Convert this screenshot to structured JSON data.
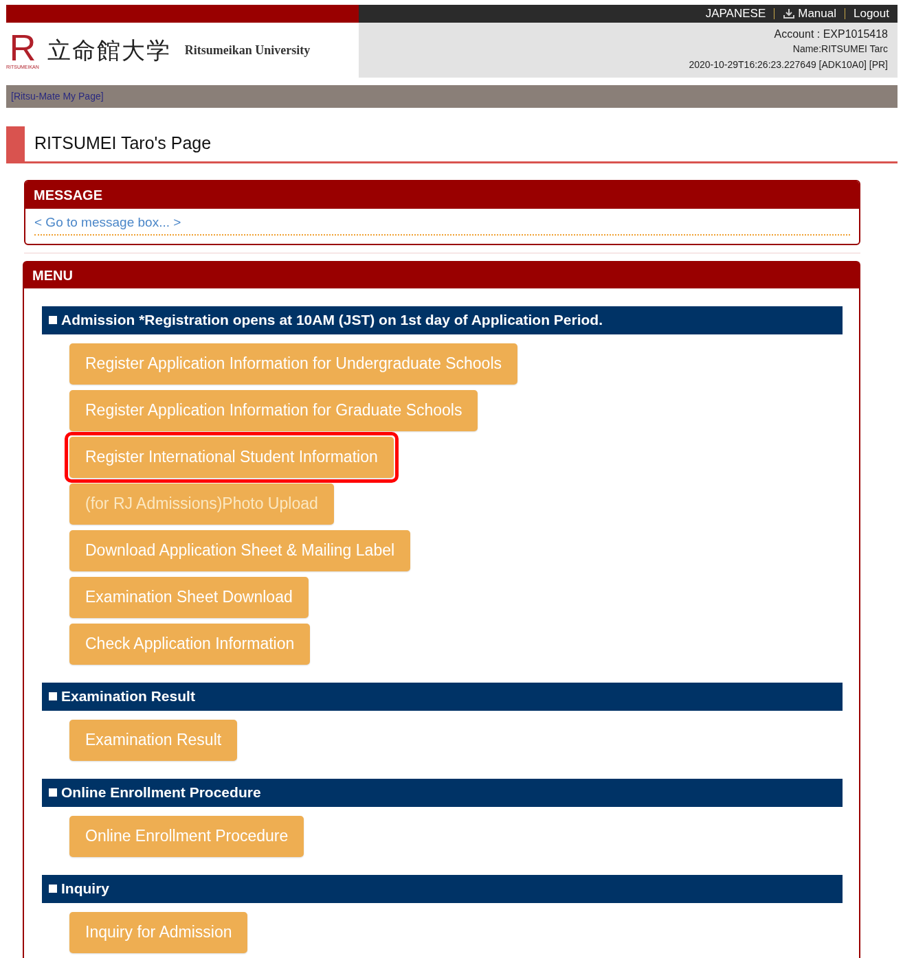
{
  "top_links": [
    {
      "kind": "text",
      "label": "JAPANESE"
    },
    {
      "kind": "download",
      "label": "Manual"
    },
    {
      "kind": "text",
      "label": "Logout"
    }
  ],
  "logo": {
    "mark": "R",
    "mark_caption": "RITSUMEIKAN",
    "name_ja": "立命館大学",
    "name_en": "Ritsumeikan University"
  },
  "account": {
    "account": "Account : EXP1015418",
    "name": "Name:RITSUMEI Tarc",
    "timestamp": "2020-10-29T16:26:23.227649 [ADK10A0] [PR]"
  },
  "breadcrumb": "[Ritsu-Mate My Page]",
  "page_title": "RITSUMEI Taro's Page",
  "message": {
    "title": "MESSAGE",
    "link": "< Go to message box... >"
  },
  "menu": {
    "title": "MENU",
    "sections": [
      {
        "title": "Admission *Registration opens at 10AM (JST) on 1st day of Application Period.",
        "buttons": [
          {
            "label": "Register Application Information for Undergraduate Schools",
            "disabled": false,
            "highlighted": false
          },
          {
            "label": "Register Application Information for Graduate Schools",
            "disabled": false,
            "highlighted": false
          },
          {
            "label": "Register International Student Information",
            "disabled": false,
            "highlighted": true
          },
          {
            "label": "(for RJ Admissions)Photo Upload",
            "disabled": true,
            "highlighted": false
          },
          {
            "label": "Download Application Sheet & Mailing Label",
            "disabled": false,
            "highlighted": false
          },
          {
            "label": "Examination Sheet Download",
            "disabled": false,
            "highlighted": false
          },
          {
            "label": "Check Application Information",
            "disabled": false,
            "highlighted": false
          }
        ]
      },
      {
        "title": "Examination Result",
        "buttons": [
          {
            "label": "Examination Result",
            "disabled": false,
            "highlighted": false
          }
        ]
      },
      {
        "title": "Online Enrollment Procedure",
        "buttons": [
          {
            "label": "Online Enrollment Procedure",
            "disabled": false,
            "highlighted": false
          }
        ]
      },
      {
        "title": "Inquiry",
        "buttons": [
          {
            "label": "Inquiry for Admission",
            "disabled": false,
            "highlighted": false
          }
        ]
      }
    ]
  }
}
